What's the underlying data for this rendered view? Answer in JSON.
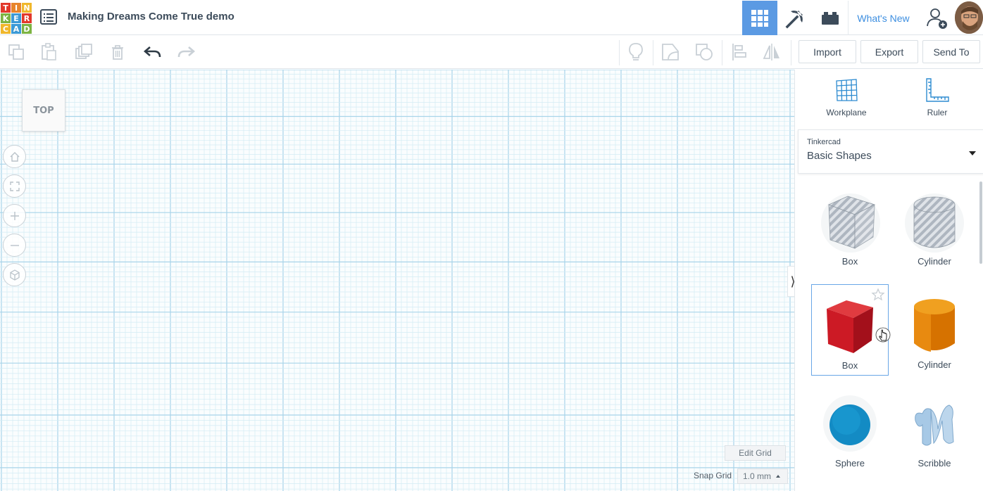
{
  "app": {
    "logo_letters": [
      "T",
      "I",
      "N",
      "K",
      "E",
      "R",
      "C",
      "A",
      "D"
    ],
    "logo_colors": [
      "#e2382b",
      "#e8842b",
      "#f0b72b",
      "#7cb342",
      "#3c9ad6",
      "#e2382b",
      "#f0b72b",
      "#3c9ad6",
      "#7cb342"
    ],
    "title": "Making Dreams Come True demo"
  },
  "header": {
    "whats_new": "What's New",
    "active_view": "3d-design",
    "accent": "#5b9ae3"
  },
  "toolbar": {
    "import_label": "Import",
    "export_label": "Export",
    "send_to_label": "Send To"
  },
  "workplane": {
    "view_cube_label": "TOP",
    "edit_grid_label": "Edit Grid",
    "snap_grid_label": "Snap Grid",
    "snap_grid_value": "1.0 mm"
  },
  "panel": {
    "workplane_label": "Workplane",
    "ruler_label": "Ruler",
    "library_category": "Tinkercad",
    "library_name": "Basic Shapes",
    "shapes": [
      {
        "label": "Box",
        "kind": "box-hole"
      },
      {
        "label": "Cylinder",
        "kind": "cylinder-hole"
      },
      {
        "label": "Box",
        "kind": "box-solid",
        "color": "#d11f2b"
      },
      {
        "label": "Cylinder",
        "kind": "cylinder-solid",
        "color": "#e07b00"
      },
      {
        "label": "Sphere",
        "kind": "sphere",
        "color": "#1591cc"
      },
      {
        "label": "Scribble",
        "kind": "scribble",
        "color": "#a7c9e6"
      }
    ]
  }
}
